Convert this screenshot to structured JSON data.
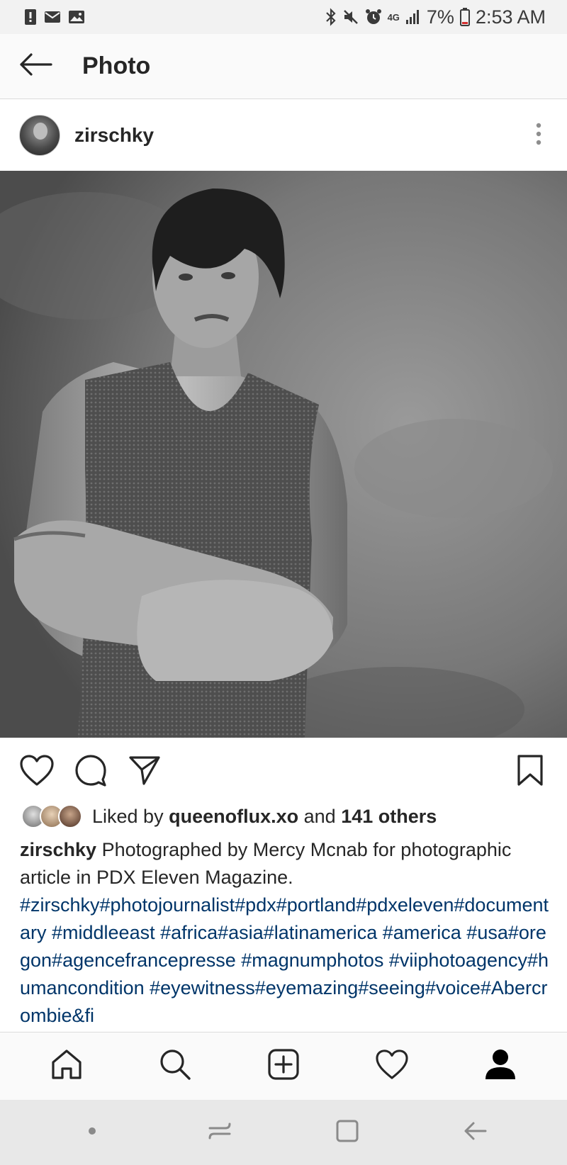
{
  "status_bar": {
    "battery": "7%",
    "time": "2:53 AM",
    "network": "4G"
  },
  "header": {
    "title": "Photo"
  },
  "post": {
    "username": "zirschky",
    "likes": {
      "prefix": "Liked by",
      "user": "queenoflux.xo",
      "connector": "and",
      "others": "141 others"
    },
    "caption": {
      "user": "zirschky",
      "text": "Photographed by Mercy Mcnab for photographic article in PDX Eleven Magazine.",
      "hashtags": "#zirschky#photojournalist#pdx#portland#pdxeleven#documentary #middleeast #africa#asia#latinamerica #america #usa#oregon#agencefrancepresse #magnumphotos #viiphotoagency#humancondition #eyewitness#eyemazing#seeing#voice#Abercrombie&fi"
    }
  },
  "icons": {
    "back": "arrow-left-icon",
    "more": "more-vertical-icon",
    "like": "heart-icon",
    "comment": "comment-icon",
    "share": "send-icon",
    "save": "bookmark-icon",
    "nav_home": "home-icon",
    "nav_search": "search-icon",
    "nav_add": "add-post-icon",
    "nav_activity": "heart-icon",
    "nav_profile": "profile-icon"
  },
  "colors": {
    "hashtag": "#003569",
    "text": "#262626",
    "divider": "#dbdbdb"
  }
}
